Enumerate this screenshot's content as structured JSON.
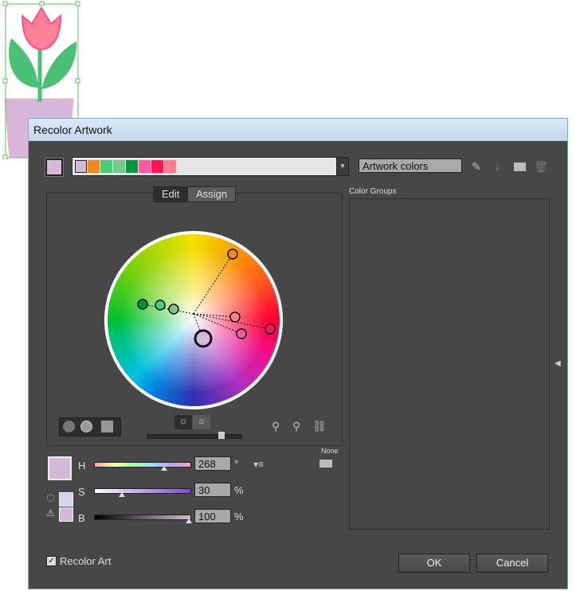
{
  "dialog": {
    "title": "Recolor Artwork"
  },
  "colors": {
    "current": "#d6b9d9",
    "strip": [
      "#d6b9d9",
      "#f08c1e",
      "#4ccb78",
      "#7cc592",
      "#009640",
      "#ff5aa0",
      "#ff1456",
      "#ff7f8e"
    ]
  },
  "artwork_name": "Artwork colors",
  "tabs": {
    "edit": "Edit",
    "assign": "Assign"
  },
  "color_groups_label": "Color Groups",
  "hsb": {
    "h_label": "H",
    "h_value": "268",
    "h_unit": "°",
    "s_label": "S",
    "s_value": "30",
    "s_unit": "%",
    "b_label": "B",
    "b_value": "100",
    "b_unit": "%",
    "h_fraction": 0.74,
    "s_fraction": 0.3,
    "b_fraction": 1.0
  },
  "library": "None",
  "recolor_art": {
    "label": "Recolor Art",
    "checked": true
  },
  "buttons": {
    "ok": "OK",
    "cancel": "Cancel"
  }
}
